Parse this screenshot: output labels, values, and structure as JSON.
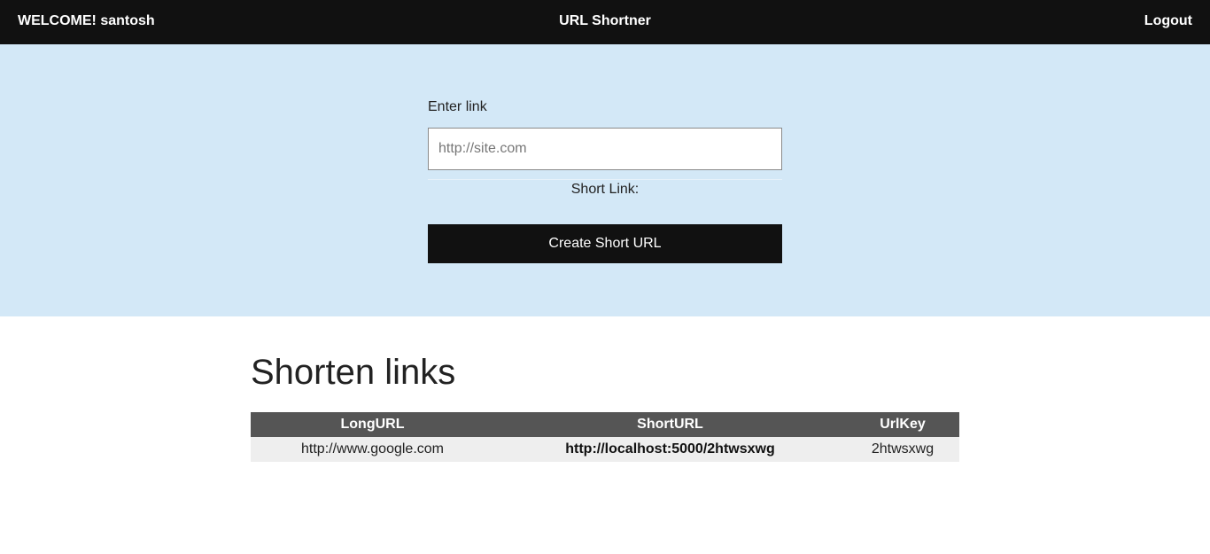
{
  "header": {
    "welcome": "WELCOME! santosh",
    "title": "URL Shortner",
    "logout": "Logout"
  },
  "form": {
    "label": "Enter link",
    "input_value": "",
    "input_placeholder": "http://site.com",
    "short_link_label": "Short Link:",
    "short_link_value": "",
    "submit_label": "Create Short URL"
  },
  "links": {
    "heading": "Shorten links",
    "columns": [
      "LongURL",
      "ShortURL",
      "UrlKey"
    ],
    "rows": [
      {
        "long_url": "http://www.google.com",
        "short_url": "http://localhost:5000/2htwsxwg",
        "url_key": "2htwsxwg"
      }
    ]
  },
  "colors": {
    "topbar": "#111111",
    "hero": "#d3e8f7",
    "button": "#111111",
    "table_header": "#555555",
    "table_row": "#eeeeee"
  }
}
